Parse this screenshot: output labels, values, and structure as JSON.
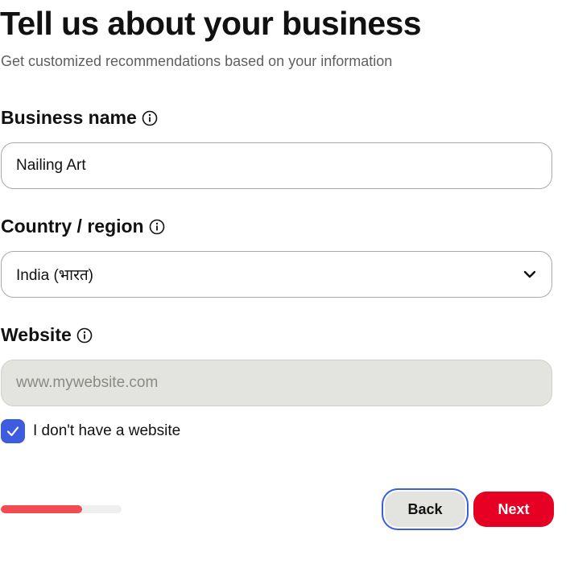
{
  "header": {
    "title": "Tell us about your business",
    "subtitle": "Get customized recommendations based on your information"
  },
  "business_name": {
    "label": "Business name",
    "value": "Nailing Art",
    "info_icon": "info-circle-icon"
  },
  "country": {
    "label": "Country / region",
    "selected": "India (भारत)",
    "info_icon": "info-circle-icon",
    "dropdown_icon": "chevron-down-icon"
  },
  "website": {
    "label": "Website",
    "placeholder": "www.mywebsite.com",
    "value": "",
    "disabled": true,
    "info_icon": "info-circle-icon"
  },
  "no_website": {
    "label": "I don't have a website",
    "checked": true
  },
  "progress": {
    "fraction": 0.67
  },
  "buttons": {
    "back": "Back",
    "next": "Next"
  },
  "colors": {
    "accent_blue": "#3d5ce0",
    "brand_red": "#e60023",
    "progress_red": "#f24b53",
    "disabled_bg": "#e3e3df"
  }
}
